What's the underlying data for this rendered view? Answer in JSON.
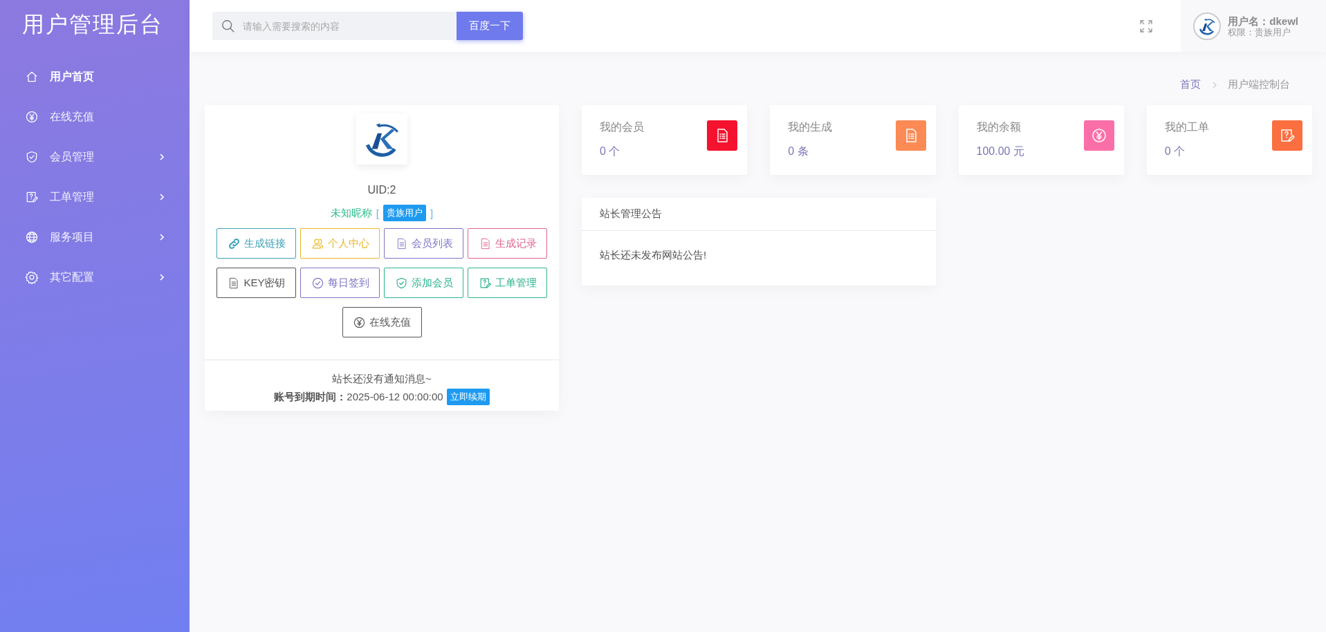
{
  "sidebar": {
    "title": "用户管理后台",
    "items": [
      {
        "label": "用户首页",
        "kind": "home",
        "selected": true,
        "has_children": false
      },
      {
        "label": "在线充值",
        "kind": "yen",
        "selected": false,
        "has_children": false
      },
      {
        "label": "会员管理",
        "kind": "shield",
        "selected": false,
        "has_children": true
      },
      {
        "label": "工单管理",
        "kind": "ticket",
        "selected": false,
        "has_children": true
      },
      {
        "label": "服务项目",
        "kind": "globe",
        "selected": false,
        "has_children": true
      },
      {
        "label": "其它配置",
        "kind": "gear",
        "selected": false,
        "has_children": true
      }
    ]
  },
  "topbar": {
    "search": {
      "placeholder": "请输入需要搜索的内容",
      "button": "百度一下"
    },
    "user": {
      "name": "用户名：dkewl",
      "role": "权限：贵族用户"
    }
  },
  "breadcrumb": [
    "首页",
    "用户端控制台"
  ],
  "profile": {
    "uid": "UID:2",
    "nickname": "未知昵称",
    "bracket_open": "[",
    "badge": "贵族用户",
    "bracket_close": "]",
    "buttons": [
      {
        "label": "生成链接",
        "kind": "link",
        "color": "#3fa2b8"
      },
      {
        "label": "个人中心",
        "kind": "person",
        "color": "#e9b726"
      },
      {
        "label": "会员列表",
        "kind": "document",
        "color": "#7d76c2"
      },
      {
        "label": "生成记录",
        "kind": "document",
        "color": "#e0628a"
      },
      {
        "label": "KEY密钥",
        "kind": "document",
        "color": "#555555"
      },
      {
        "label": "每日签到",
        "kind": "check",
        "color": "#7d76c2"
      },
      {
        "label": "添加会员",
        "kind": "shield",
        "color": "#2db390"
      },
      {
        "label": "工单管理",
        "kind": "ticket",
        "color": "#2db390"
      },
      {
        "label": "在线充值",
        "kind": "yen",
        "color": "#555555"
      }
    ],
    "notice": "站长还没有通知消息~",
    "expiry": "**账号到期时间：**2025-06-12 00:00:00",
    "renew": "立即续期"
  },
  "stats": [
    {
      "title": "我的会员",
      "value": "0 个",
      "kind": "list",
      "color": "#f5122e"
    },
    {
      "title": "我的生成",
      "value": "0 条",
      "kind": "list",
      "color": "#fb8a55"
    },
    {
      "title": "我的余额",
      "value": "100.00 元",
      "kind": "yen",
      "color": "#fb6fa8"
    },
    {
      "title": "我的工单",
      "value": "0 个",
      "kind": "ticket",
      "color": "#fb6f40"
    }
  ],
  "announcement": {
    "title": "站长管理公告",
    "body": "站长还未发布网站公告!"
  }
}
